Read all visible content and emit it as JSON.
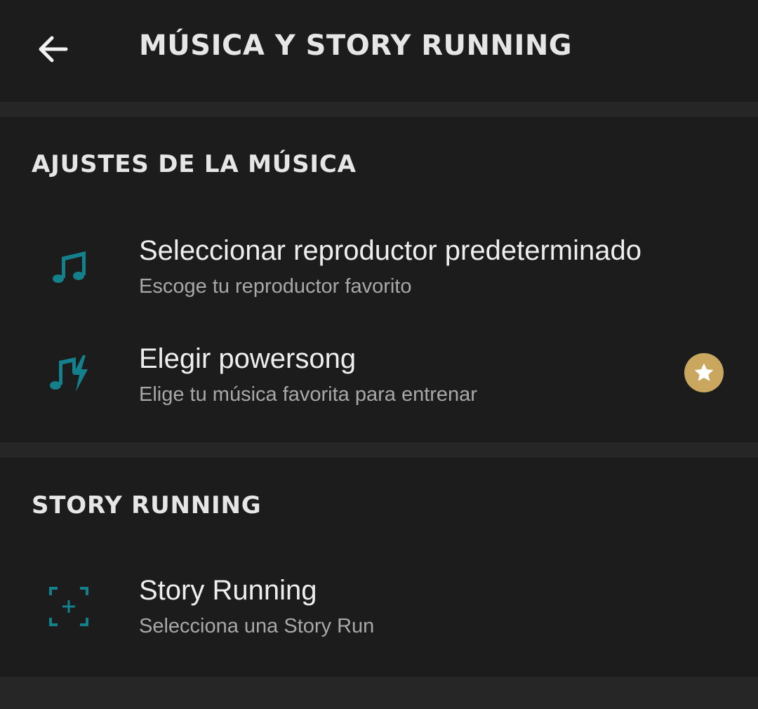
{
  "header": {
    "title": "MÚSICA Y STORY RUNNING",
    "back_icon": "arrow-left-icon"
  },
  "music_section": {
    "title": "AJUSTES DE LA MÚSICA",
    "items": [
      {
        "icon": "music-note-icon",
        "title": "Seleccionar reproductor predeterminado",
        "subtitle": "Escoge tu reproductor favorito"
      },
      {
        "icon": "powersong-icon",
        "title": "Elegir powersong",
        "subtitle": "Elige tu música favorita para entrenar",
        "badge_icon": "premium-star-icon"
      }
    ]
  },
  "story_section": {
    "title": "STORY RUNNING",
    "items": [
      {
        "icon": "story-run-add-icon",
        "title": "Story Running",
        "subtitle": "Selecciona una Story Run"
      }
    ]
  },
  "colors": {
    "background": "#262626",
    "surface": "#1c1c1c",
    "accent_teal": "#14808c",
    "premium_gold": "#c9a75e",
    "text_primary": "#eeeeee",
    "text_secondary": "#a8a8a8"
  }
}
